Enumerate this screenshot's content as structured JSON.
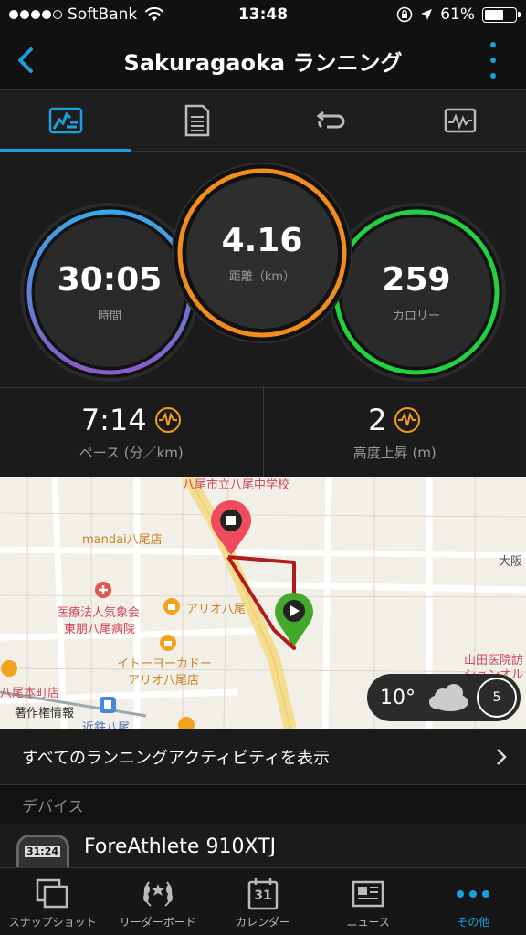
{
  "status": {
    "carrier": "SoftBank",
    "signal_bars": 4,
    "time": "13:48",
    "battery": "61%",
    "battery_level": 0.61
  },
  "nav": {
    "title": "Sakuragaoka ランニング",
    "back_icon": "chevron-left-icon",
    "more_icon": "more-vertical-icon",
    "accent": "#1aa0e0"
  },
  "tabs": [
    {
      "icon": "stats-icon",
      "active": true
    },
    {
      "icon": "details-icon",
      "active": false
    },
    {
      "icon": "laps-icon",
      "active": false
    },
    {
      "icon": "chart-icon",
      "active": false
    }
  ],
  "stats": {
    "time": {
      "value": "30:05",
      "label": "時間"
    },
    "distance": {
      "value": "4.16",
      "label": "距離（km）",
      "color": "#f28c1c"
    },
    "calories": {
      "value": "259",
      "label": "カロリー",
      "color": "#22d040"
    },
    "pace": {
      "value": "7:14",
      "label": "ペース (分／km)"
    },
    "elevation": {
      "value": "2",
      "label": "高度上昇 (m)"
    }
  },
  "map": {
    "labels": [
      {
        "text": "八尾市立八尾中学校"
      },
      {
        "text": "mandai八尾店"
      },
      {
        "text": "大阪"
      },
      {
        "text": "医療法人気象会"
      },
      {
        "text": "東朋八尾病院"
      },
      {
        "text": "アリオ八尾"
      },
      {
        "text": "イトーヨーカドー"
      },
      {
        "text": "アリオ八尾店"
      },
      {
        "text": "八尾本町店"
      },
      {
        "text": "著作権情報"
      },
      {
        "text": "近鉄八尾"
      },
      {
        "text": "山田医院訪"
      },
      {
        "text": "ションオル"
      }
    ],
    "weather": {
      "temp": "10°",
      "wind": "5"
    }
  },
  "links": {
    "all_activities": "すべてのランニングアクティビティを表示",
    "devices_header": "デバイス",
    "device_name": "ForeAthlete 910XTJ",
    "watch_time": "31:24"
  },
  "bottom_nav": [
    {
      "label": "スナップショット",
      "icon": "snapshot-icon"
    },
    {
      "label": "リーダーボード",
      "icon": "laurel-icon"
    },
    {
      "label": "カレンダー",
      "icon": "calendar-icon",
      "day": "31"
    },
    {
      "label": "ニュース",
      "icon": "news-icon"
    },
    {
      "label": "その他",
      "icon": "more-horizontal-icon",
      "active": true
    }
  ]
}
